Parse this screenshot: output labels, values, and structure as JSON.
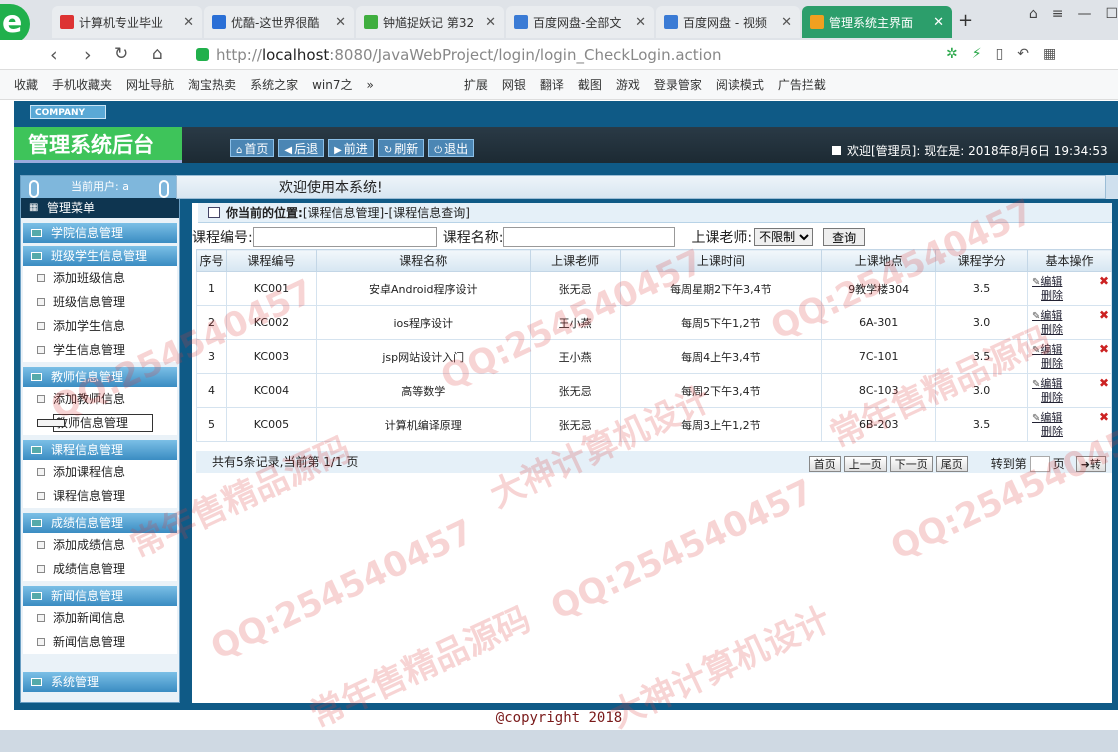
{
  "browser": {
    "tabs": [
      {
        "label": "计算机专业毕业",
        "color": "#d33"
      },
      {
        "label": "优酷-这世界很酷",
        "color": "#2a6fd6"
      },
      {
        "label": "钟馗捉妖记 第32",
        "color": "#3fae3f"
      },
      {
        "label": "百度网盘-全部文",
        "color": "#3a7bd5"
      },
      {
        "label": "百度网盘 - 视频",
        "color": "#3a7bd5"
      },
      {
        "label": "管理系统主界面",
        "color": "#f0a020"
      }
    ],
    "new_tab": "+",
    "url_prefix": "http://",
    "url_host": "localhost",
    "url_rest": ":8080/JavaWebProject/login/login_CheckLogin.action",
    "bookmarks": [
      "收藏",
      "手机收藏夹",
      "网址导航",
      "淘宝热卖",
      "系统之家",
      "win7之",
      "»",
      "扩展",
      "网银",
      "翻译",
      "截图",
      "游戏",
      "登录管家",
      "阅读模式",
      "广告拦截"
    ]
  },
  "app": {
    "company": "COMPANY",
    "title": "管理系统后台",
    "top_buttons": [
      {
        "icon": "home-icon",
        "label": "首页"
      },
      {
        "icon": "back-icon",
        "label": "后退"
      },
      {
        "icon": "forward-icon",
        "label": "前进"
      },
      {
        "icon": "refresh-icon",
        "label": "刷新"
      },
      {
        "icon": "power-icon",
        "label": "退出"
      }
    ],
    "welcome": "欢迎[管理员]:   现在是: 2018年8月6日 19:34:53",
    "welcome_bar": "欢迎使用本系统!"
  },
  "sidebar": {
    "current_user": "当前用户: a",
    "menu_title": "管理菜单",
    "groups": [
      {
        "title": "学院信息管理",
        "items": []
      },
      {
        "title": "班级学生信息管理",
        "items": [
          "添加班级信息",
          "班级信息管理",
          "添加学生信息",
          "学生信息管理"
        ]
      },
      {
        "title": "教师信息管理",
        "items": [
          "添加教师信息",
          "教师信息管理"
        ]
      },
      {
        "title": "课程信息管理",
        "items": [
          "添加课程信息",
          "课程信息管理"
        ]
      },
      {
        "title": "成绩信息管理",
        "items": [
          "添加成绩信息",
          "成绩信息管理"
        ]
      },
      {
        "title": "新闻信息管理",
        "items": [
          "添加新闻信息",
          "新闻信息管理"
        ]
      }
    ],
    "system_menu": "系统管理"
  },
  "main": {
    "breadcrumb_label": "你当前的位置:",
    "breadcrumb_path": "[课程信息管理]-[课程信息查询]",
    "search": {
      "course_no_label": "课程编号:",
      "course_no_value": "",
      "course_name_label": "课程名称:",
      "course_name_value": "",
      "teacher_label": "上课老师:",
      "teacher_value": "不限制",
      "query_button": "查询"
    },
    "table": {
      "headers": [
        "序号",
        "课程编号",
        "课程名称",
        "上课老师",
        "上课时间",
        "上课地点",
        "课程学分",
        "基本操作"
      ],
      "rows": [
        [
          "1",
          "KC001",
          "安卓Android程序设计",
          "张无忌",
          "每周星期2下午3,4节",
          "9教学楼304",
          "3.5"
        ],
        [
          "2",
          "KC002",
          "ios程序设计",
          "王小燕",
          "每周5下午1,2节",
          "6A-301",
          "3.0"
        ],
        [
          "3",
          "KC003",
          "jsp网站设计入门",
          "王小燕",
          "每周4上午3,4节",
          "7C-101",
          "3.5"
        ],
        [
          "4",
          "KC004",
          "高等数学",
          "张无忌",
          "每周2下午3,4节",
          "8C-103",
          "3.0"
        ],
        [
          "5",
          "KC005",
          "计算机编译原理",
          "张无忌",
          "每周3上午1,2节",
          "6B-203",
          "3.5"
        ]
      ],
      "edit_label": "编辑",
      "delete_label": "删除"
    },
    "pager": {
      "summary": "共有5条记录,当前第 1/1 页",
      "first": "首页",
      "prev": "上一页",
      "next": "下一页",
      "last": "尾页",
      "goto_label": "转到第",
      "page_unit": "页",
      "goto_button": "➜转"
    }
  },
  "footer": "@copyright 2018",
  "watermarks": [
    "QQ:254540457",
    "常年售精品源码",
    "大神计算机设计"
  ]
}
